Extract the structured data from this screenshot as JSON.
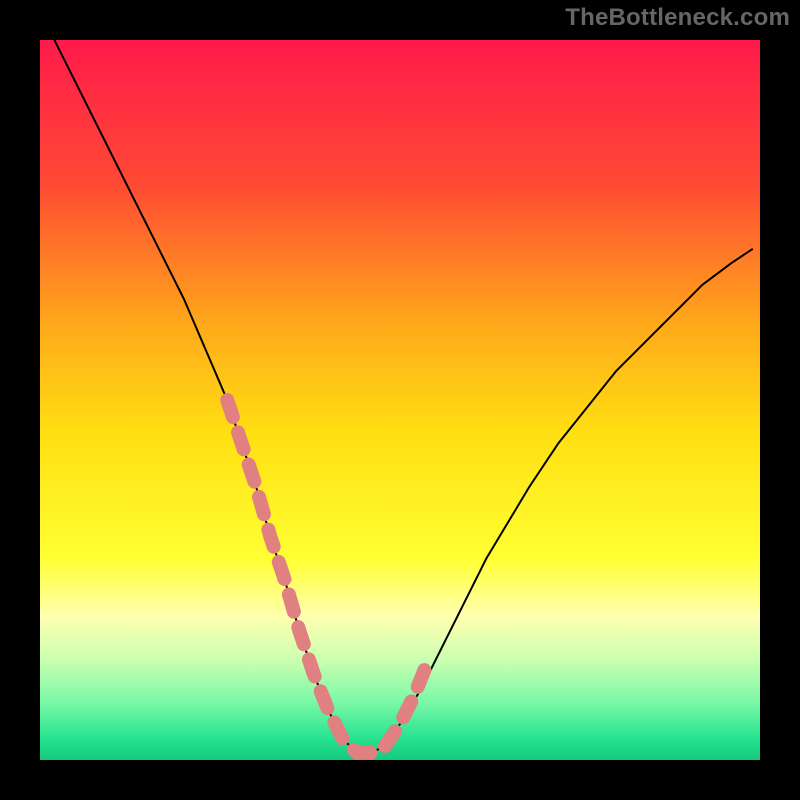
{
  "watermark": "TheBottleneck.com",
  "chart_data": {
    "type": "line",
    "title": "",
    "xlabel": "",
    "ylabel": "",
    "xlim": [
      0,
      100
    ],
    "ylim": [
      0,
      100
    ],
    "background_gradient": [
      {
        "pos": 0.0,
        "color": "#ff1a4b"
      },
      {
        "pos": 0.2,
        "color": "#ff4a33"
      },
      {
        "pos": 0.4,
        "color": "#ffab1a"
      },
      {
        "pos": 0.55,
        "color": "#ffe012"
      },
      {
        "pos": 0.72,
        "color": "#ffff33"
      },
      {
        "pos": 0.8,
        "color": "#ffffaf"
      },
      {
        "pos": 0.86,
        "color": "#ccffb0"
      },
      {
        "pos": 0.92,
        "color": "#79f8a7"
      },
      {
        "pos": 0.97,
        "color": "#26e38f"
      },
      {
        "pos": 1.0,
        "color": "#13c97e"
      }
    ],
    "series": [
      {
        "name": "bottleneck-curve",
        "stroke": "#000000",
        "x": [
          2,
          5,
          8,
          11,
          14,
          17,
          20,
          23,
          26,
          28,
          30,
          32,
          34,
          36,
          38,
          40,
          42,
          44,
          46,
          48,
          50,
          53,
          56,
          59,
          62,
          65,
          68,
          72,
          76,
          80,
          84,
          88,
          92,
          96,
          99
        ],
        "values": [
          100,
          94,
          88,
          82,
          76,
          70,
          64,
          57,
          50,
          44,
          38,
          31,
          25,
          18,
          12,
          7,
          3,
          1,
          1,
          2,
          5,
          10,
          16,
          22,
          28,
          33,
          38,
          44,
          49,
          54,
          58,
          62,
          66,
          69,
          71
        ]
      }
    ],
    "highlight_band": {
      "name": "recommended-zone",
      "color": "#e08080",
      "stroke_width": 14,
      "x": [
        26,
        28,
        30,
        32,
        34,
        36,
        38,
        40,
        42,
        44,
        46,
        48,
        50,
        52,
        54
      ],
      "values": [
        50,
        44,
        38,
        31,
        25,
        18,
        12,
        7,
        3,
        1,
        1,
        2,
        5,
        9,
        14
      ]
    }
  }
}
